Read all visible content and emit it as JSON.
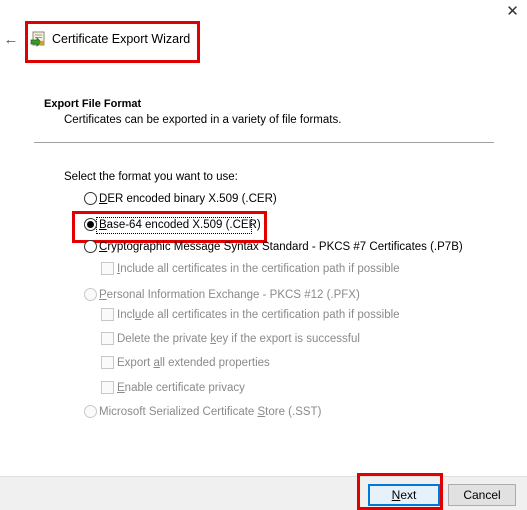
{
  "window": {
    "close_glyph": "✕",
    "back_glyph": "←",
    "title": "Certificate Export Wizard",
    "icon": "certificate-wizard-icon"
  },
  "section": {
    "title": "Export File Format",
    "description": "Certificates can be exported in a variety of file formats."
  },
  "prompt": "Select the format you want to use:",
  "formats": {
    "der": {
      "accel": "D",
      "rest": "ER encoded binary X.509 (.CER)",
      "selected": false,
      "enabled": true
    },
    "base64": {
      "accel": "B",
      "rest": "ase-64 encoded X.509 (.CER)",
      "selected": true,
      "enabled": true
    },
    "pkcs7": {
      "accel": "C",
      "rest": "ryptographic Message Syntax Standard - PKCS #7 Certificates (.P7B)",
      "selected": false,
      "enabled": true
    },
    "pkcs7_include": {
      "pre": "",
      "accel": "I",
      "rest": "nclude all certificates in the certification path if possible",
      "checked": false,
      "enabled": false
    },
    "pfx": {
      "pre": "",
      "accel": "P",
      "rest": "ersonal Information Exchange - PKCS #12 (.PFX)",
      "selected": false,
      "enabled": false
    },
    "pfx_include": {
      "pre": "Incl",
      "accel": "u",
      "rest": "de all certificates in the certification path if possible",
      "checked": false,
      "enabled": false
    },
    "pfx_delete_key": {
      "pre": "Delete the private ",
      "accel": "k",
      "rest": "ey if the export is successful",
      "checked": false,
      "enabled": false
    },
    "pfx_export_props": {
      "pre": "Export ",
      "accel": "a",
      "rest": "ll extended properties",
      "checked": false,
      "enabled": false
    },
    "pfx_privacy": {
      "pre": "",
      "accel": "E",
      "rest": "nable certificate privacy",
      "checked": false,
      "enabled": false
    },
    "sst": {
      "pre": "Microsoft Serialized Certificate ",
      "accel": "S",
      "rest": "tore (.SST)",
      "selected": false,
      "enabled": false
    }
  },
  "buttons": {
    "next": {
      "accel": "N",
      "rest": "ext"
    },
    "cancel": "Cancel"
  },
  "colors": {
    "annotation_red": "#e00000",
    "default_button_border": "#0078d7",
    "footer_bg": "#f0f0f0",
    "disabled_text": "#8a8a8a"
  }
}
